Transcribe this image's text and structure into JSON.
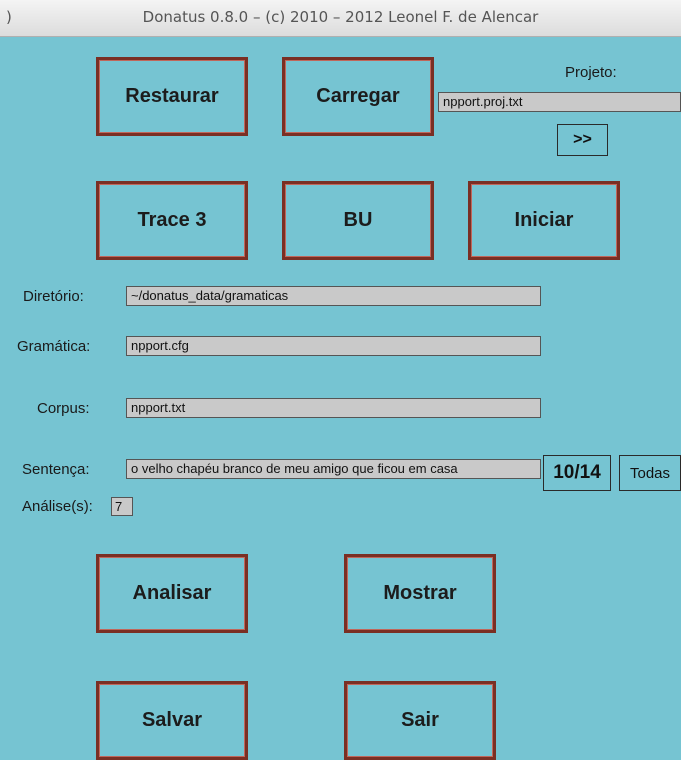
{
  "window": {
    "title": "Donatus 0.8.0 – (c) 2010 – 2012 Leonel F. de Alencar",
    "edge_glyph": ")"
  },
  "buttons": {
    "restaurar": "Restaurar",
    "carregar": "Carregar",
    "next": ">>",
    "trace": "Trace 3",
    "bu": "BU",
    "iniciar": "Iniciar",
    "counter": "10/14",
    "todas": "Todas",
    "analisar": "Analisar",
    "mostrar": "Mostrar",
    "salvar": "Salvar",
    "sair": "Sair"
  },
  "projeto": {
    "label": "Projeto:",
    "value": "npport.proj.txt"
  },
  "fields": {
    "diretorio": {
      "label": "Diretório:",
      "value": "~/donatus_data/gramaticas"
    },
    "gramatica": {
      "label": "Gramática:",
      "value": "npport.cfg"
    },
    "corpus": {
      "label": "Corpus:",
      "value": "npport.txt"
    },
    "sentenca": {
      "label": "Sentença:",
      "value": "o velho chapéu branco de meu amigo que ficou em casa"
    },
    "analises": {
      "label": "Análise(s):",
      "value": "7"
    }
  }
}
